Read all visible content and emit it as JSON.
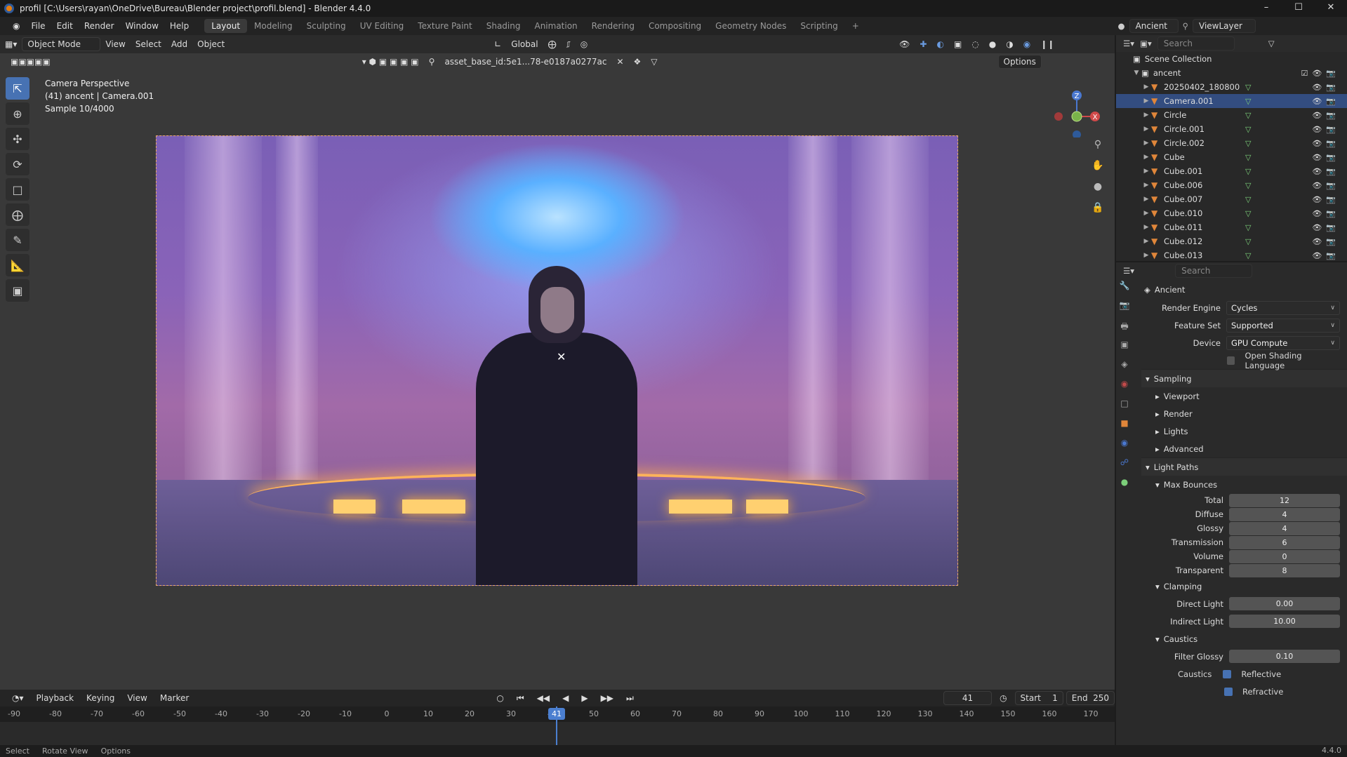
{
  "window": {
    "title": "profil [C:\\Users\\rayan\\OneDrive\\Bureau\\Blender project\\profil.blend] - Blender 4.4.0",
    "controls": [
      "–",
      "☐",
      "✕"
    ]
  },
  "menu": [
    "File",
    "Edit",
    "Render",
    "Window",
    "Help"
  ],
  "workspaces": [
    "Layout",
    "Modeling",
    "Sculpting",
    "UV Editing",
    "Texture Paint",
    "Shading",
    "Animation",
    "Rendering",
    "Compositing",
    "Geometry Nodes",
    "Scripting"
  ],
  "active_workspace": "Layout",
  "scene": {
    "name": "Ancient",
    "view_layer": "ViewLayer"
  },
  "viewport": {
    "mode": "Object Mode",
    "header_menus": [
      "View",
      "Select",
      "Add",
      "Object"
    ],
    "transform_orientation": "Global",
    "asset_path": "asset_base_id:5e1...78-e0187a0277ac",
    "options": "Options",
    "info_line1": "Camera Perspective",
    "info_line2": "(41) ancent | Camera.001",
    "info_line3": "Sample 10/4000",
    "gizmo_axes": [
      "Z",
      "X"
    ]
  },
  "tools": [
    "select-box",
    "cursor",
    "move",
    "rotate",
    "scale",
    "transform",
    "annotate",
    "measure",
    "add-cube"
  ],
  "timeline": {
    "menus": [
      "Playback",
      "Keying",
      "View",
      "Marker"
    ],
    "current_frame": "41",
    "start_label": "Start",
    "start": "1",
    "end_label": "End",
    "end": "250",
    "ruler": [
      "-90",
      "-80",
      "-70",
      "-60",
      "-50",
      "-40",
      "-30",
      "-20",
      "-10",
      "0",
      "10",
      "20",
      "30",
      "40",
      "50",
      "60",
      "70",
      "80",
      "90",
      "100",
      "110",
      "120",
      "130",
      "140",
      "150",
      "160",
      "170"
    ]
  },
  "status_bar": {
    "select": "Select",
    "rotate": "Rotate View",
    "options": "Options",
    "version": "4.4.0"
  },
  "outliner": {
    "search_placeholder": "Search",
    "root": "Scene Collection",
    "collection": "ancent",
    "items": [
      {
        "name": "20250402_180800",
        "selected": false
      },
      {
        "name": "Camera.001",
        "selected": true
      },
      {
        "name": "Circle",
        "selected": false
      },
      {
        "name": "Circle.001",
        "selected": false
      },
      {
        "name": "Circle.002",
        "selected": false
      },
      {
        "name": "Cube",
        "selected": false
      },
      {
        "name": "Cube.001",
        "selected": false
      },
      {
        "name": "Cube.006",
        "selected": false
      },
      {
        "name": "Cube.007",
        "selected": false
      },
      {
        "name": "Cube.010",
        "selected": false
      },
      {
        "name": "Cube.011",
        "selected": false
      },
      {
        "name": "Cube.012",
        "selected": false
      },
      {
        "name": "Cube.013",
        "selected": false
      }
    ]
  },
  "properties": {
    "search_placeholder": "Search",
    "scene_name": "Ancient",
    "render_engine_label": "Render Engine",
    "render_engine": "Cycles",
    "feature_set_label": "Feature Set",
    "feature_set": "Supported",
    "device_label": "Device",
    "device": "GPU Compute",
    "osl_label": "Open Shading Language",
    "sampling": "Sampling",
    "sampling_items": [
      "Viewport",
      "Render",
      "Lights",
      "Advanced"
    ],
    "light_paths": "Light Paths",
    "max_bounces": "Max Bounces",
    "bounces": [
      {
        "label": "Total",
        "value": "12"
      },
      {
        "label": "Diffuse",
        "value": "4"
      },
      {
        "label": "Glossy",
        "value": "4"
      },
      {
        "label": "Transmission",
        "value": "6"
      },
      {
        "label": "Volume",
        "value": "0"
      },
      {
        "label": "Transparent",
        "value": "8"
      }
    ],
    "clamping": "Clamping",
    "direct_light_label": "Direct Light",
    "direct_light": "0.00",
    "indirect_light_label": "Indirect Light",
    "indirect_light": "10.00",
    "caustics": "Caustics",
    "filter_glossy_label": "Filter Glossy",
    "filter_glossy": "0.10",
    "caustics_label": "Caustics",
    "reflective": "Reflective",
    "refractive": "Refractive"
  },
  "colors": {
    "accent": "#4772b3",
    "object": "#e0863a",
    "selected_row": "#334d80"
  }
}
